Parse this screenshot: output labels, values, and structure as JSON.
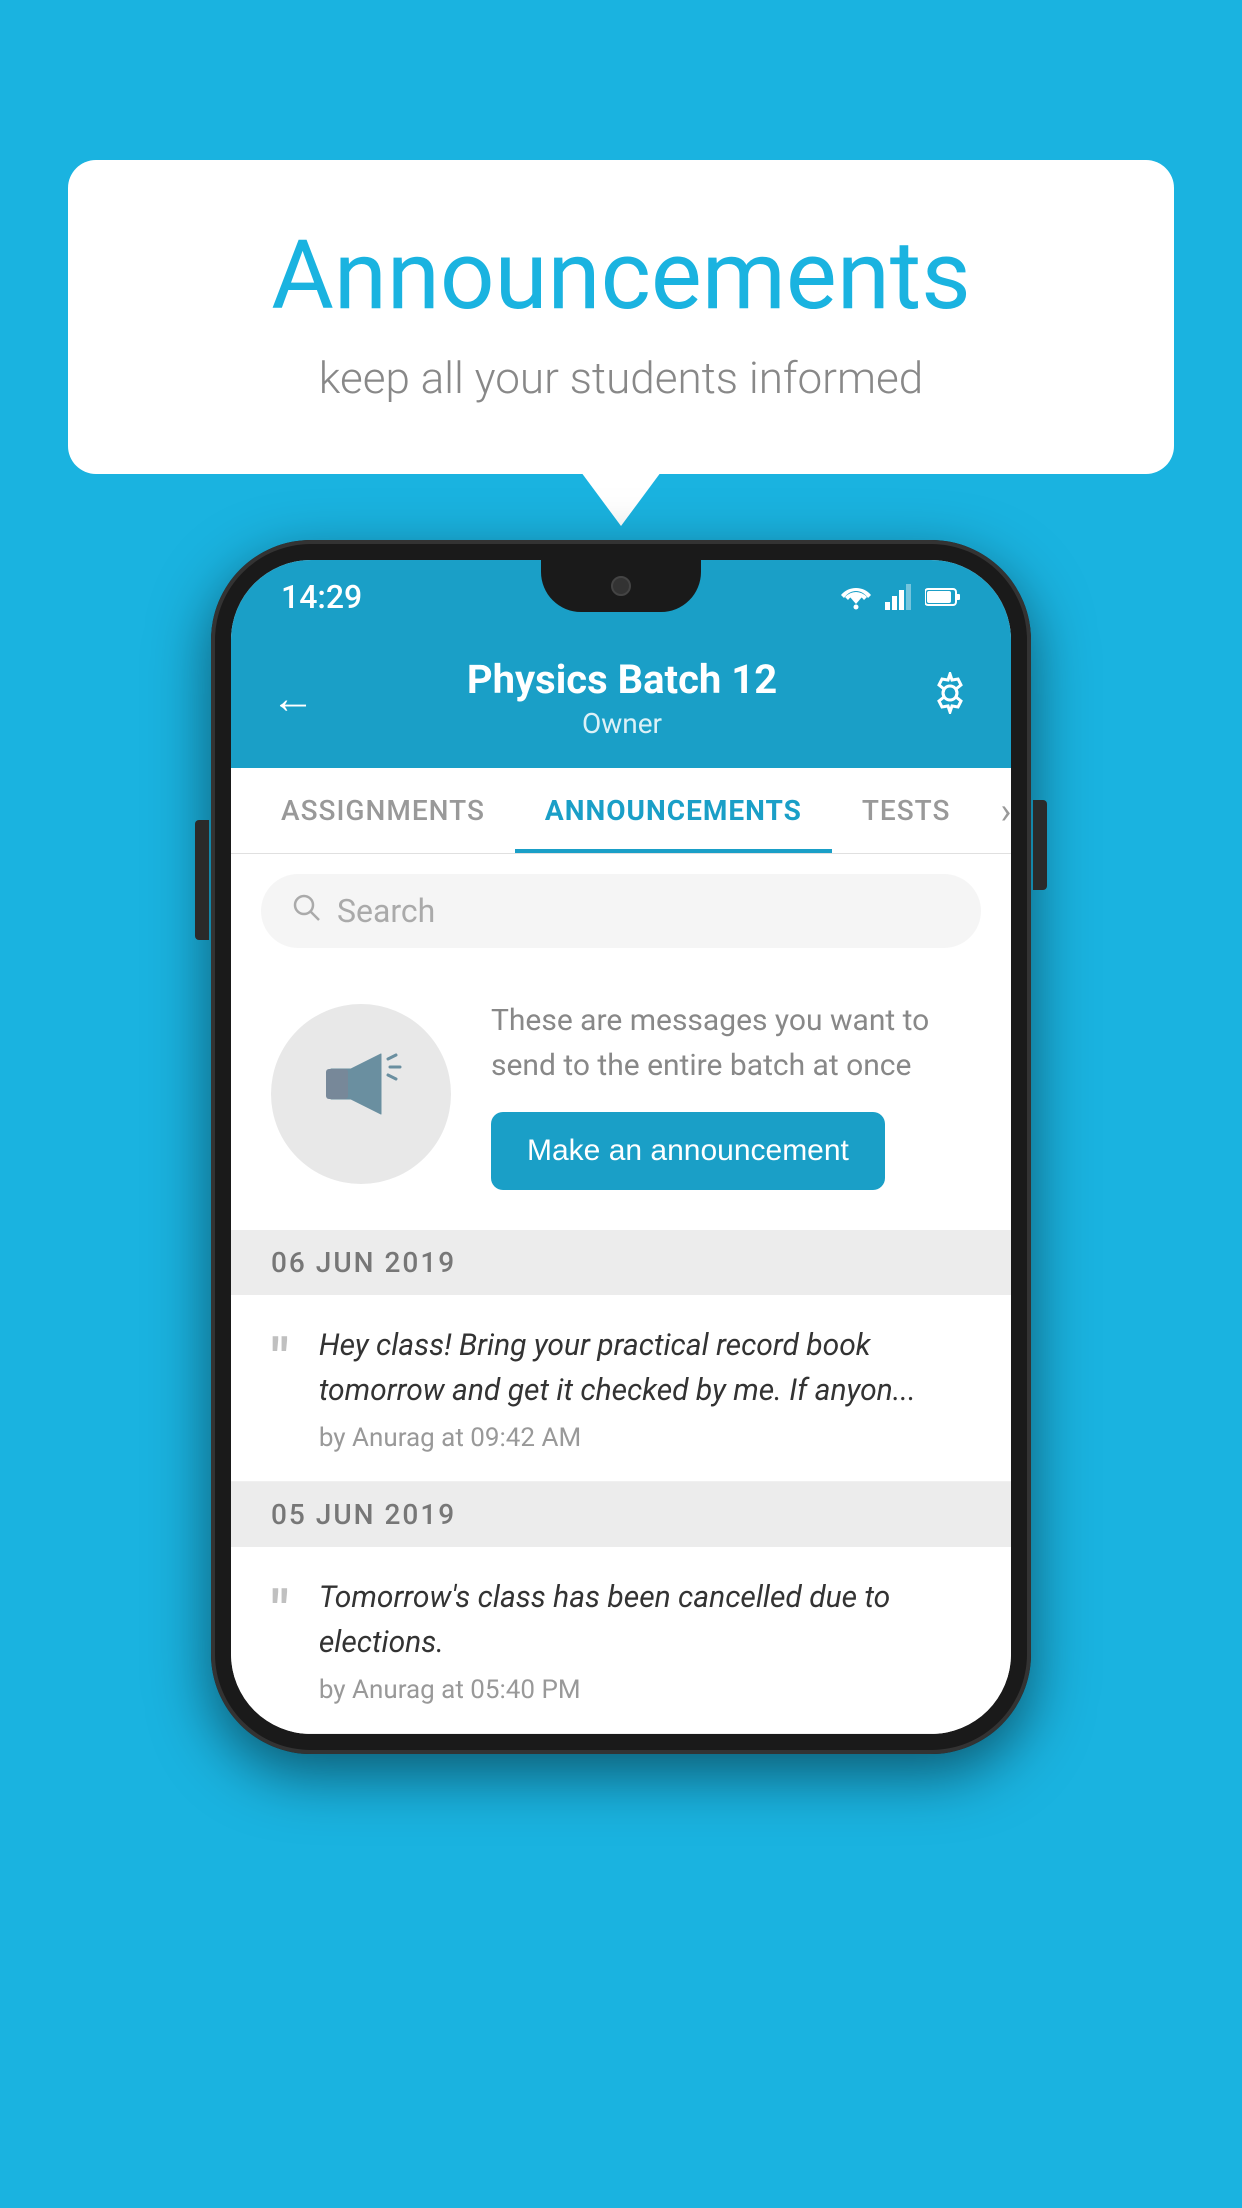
{
  "background_color": "#1ab3e0",
  "speech_bubble": {
    "title": "Announcements",
    "subtitle": "keep all your students informed"
  },
  "status_bar": {
    "time": "14:29"
  },
  "header": {
    "title": "Physics Batch 12",
    "subtitle": "Owner"
  },
  "tabs": [
    {
      "label": "ASSIGNMENTS",
      "active": false
    },
    {
      "label": "ANNOUNCEMENTS",
      "active": true
    },
    {
      "label": "TESTS",
      "active": false
    }
  ],
  "search": {
    "placeholder": "Search"
  },
  "empty_state": {
    "description": "These are messages you want to\nsend to the entire batch at once",
    "button_label": "Make an announcement"
  },
  "announcements": [
    {
      "date": "06  JUN  2019",
      "message": "Hey class! Bring your practical record book tomorrow and get it checked by me. If anyon...",
      "meta": "by Anurag at 09:42 AM"
    },
    {
      "date": "05  JUN  2019",
      "message": "Tomorrow's class has been cancelled due to elections.",
      "meta": "by Anurag at 05:40 PM"
    }
  ]
}
